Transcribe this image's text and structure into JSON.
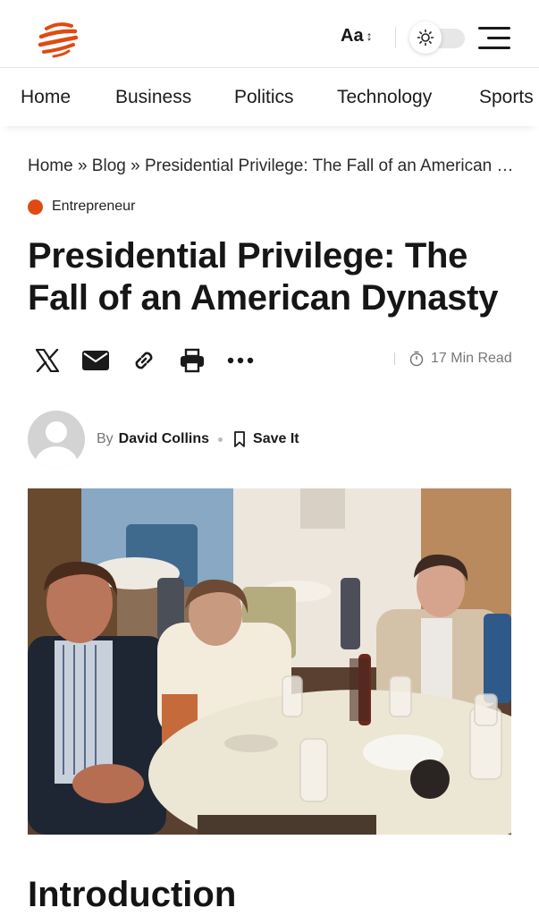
{
  "header": {
    "font_size_label": "Aa",
    "font_size_arrows": "↕",
    "logo_icon": "globe-logo-icon",
    "theme_icon": "sun-icon",
    "menu_icon": "hamburger-menu-icon",
    "brand_color": "#e04a12"
  },
  "nav": {
    "items": [
      "Home",
      "Business",
      "Politics",
      "Technology",
      "Sports"
    ]
  },
  "breadcrumb": {
    "text": "Home » Blog » Presidential Privilege: The Fall of an American Dynasty"
  },
  "category": {
    "label": "Entrepreneur"
  },
  "article": {
    "title": "Presidential Privilege: The Fall of an American Dynasty",
    "read_time": "17 Min Read",
    "author_prefix": "By",
    "author_name": "David Collins",
    "save_label": "Save It",
    "section_heading": "Introduction"
  },
  "share_icons": [
    "x-icon",
    "email-icon",
    "link-icon",
    "print-icon",
    "more-icon"
  ]
}
